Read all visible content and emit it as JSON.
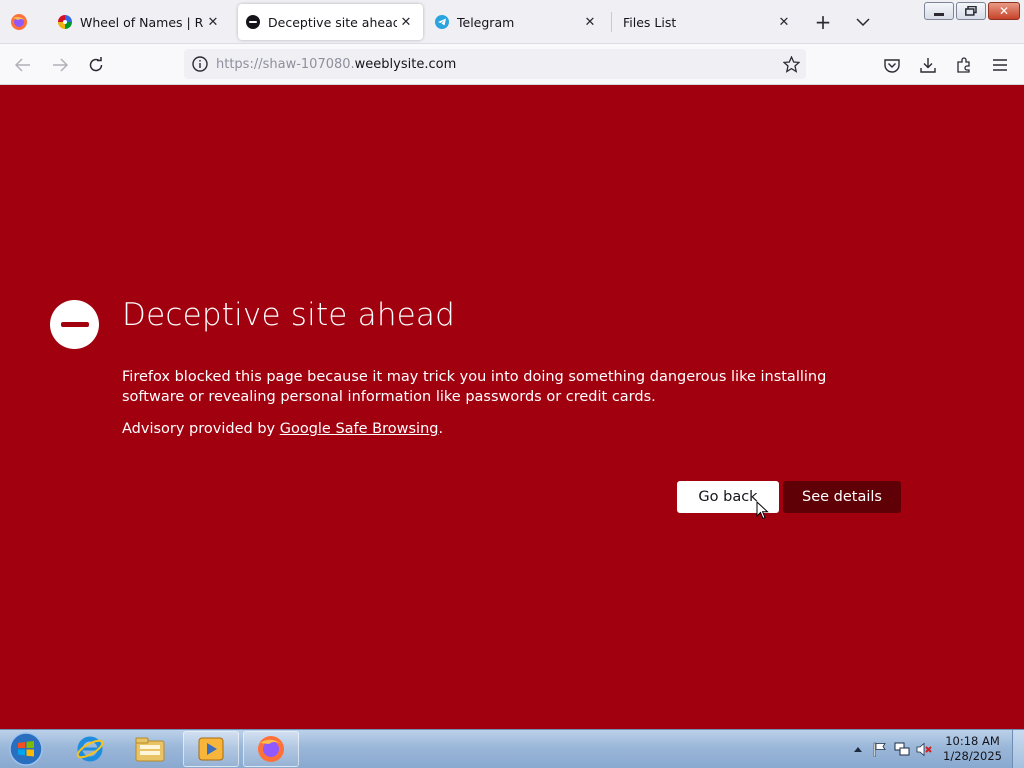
{
  "tabs": [
    {
      "title": "Wheel of Names | Random name picker",
      "favicon": "wheel-of-names-icon",
      "active": false
    },
    {
      "title": "Deceptive site ahead",
      "favicon": "blocked-icon",
      "active": true
    },
    {
      "title": "Telegram",
      "favicon": "telegram-icon",
      "active": false
    },
    {
      "title": "Files List",
      "favicon": "",
      "active": false
    }
  ],
  "url": {
    "dim_part": "https://shaw-107080.",
    "domain_part": "weeblysite.com"
  },
  "page": {
    "heading": "Deceptive site ahead",
    "description": "Firefox blocked this page because it may trick you into doing something dangerous like installing software or revealing personal information like passwords or credit cards.",
    "advisory_prefix": "Advisory provided by ",
    "advisory_link": "Google Safe Browsing",
    "advisory_suffix": ".",
    "go_back_label": "Go back",
    "see_details_label": "See details"
  },
  "taskbar": {
    "time": "10:18 AM",
    "date": "1/28/2025",
    "pinned": [
      "windows-start-icon",
      "internet-explorer-icon",
      "file-explorer-icon",
      "media-player-icon",
      "firefox-icon"
    ]
  },
  "colors": {
    "page_background": "#a1000f",
    "secondary_button": "#5e0006",
    "tab_bar": "#f0f0f4"
  }
}
